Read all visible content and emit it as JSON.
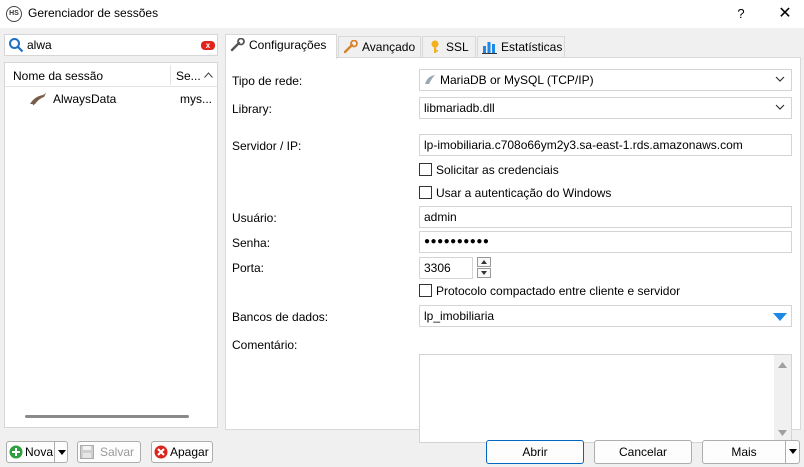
{
  "window": {
    "title": "Gerenciador de sessões",
    "help": "?",
    "close": "✕",
    "app_icon_text": "HS"
  },
  "search": {
    "value": "alwa",
    "clear_icon": "x"
  },
  "session_list": {
    "columns": [
      "Nome da sessão",
      "Se..."
    ],
    "rows": [
      {
        "name": "AlwaysData",
        "type": "mys..."
      }
    ]
  },
  "tabs": [
    {
      "label": "Configurações",
      "icon": "wrench-icon",
      "active": true
    },
    {
      "label": "Avançado",
      "icon": "wrench-orange-icon"
    },
    {
      "label": "SSL",
      "icon": "key-icon"
    },
    {
      "label": "Estatísticas",
      "icon": "bar-chart-icon"
    }
  ],
  "form": {
    "network_type_label": "Tipo de rede:",
    "network_type_value": "MariaDB or MySQL (TCP/IP)",
    "library_label": "Library:",
    "library_value": "libmariadb.dll",
    "server_label": "Servidor / IP:",
    "server_value": "lp-imobiliaria.c708o66ym2y3.sa-east-1.rds.amazonaws.com",
    "prompt_credentials": "Solicitar as credenciais",
    "windows_auth": "Usar a autenticação do Windows",
    "user_label": "Usuário:",
    "user_value": "admin",
    "password_label": "Senha:",
    "password_value": "●●●●●●●●●●",
    "port_label": "Porta:",
    "port_value": "3306",
    "compressed": "Protocolo compactado entre cliente e servidor",
    "databases_label": "Bancos de dados:",
    "databases_value": "lp_imobiliaria",
    "comment_label": "Comentário:",
    "comment_value": ""
  },
  "buttons": {
    "new": "Nova",
    "save": "Salvar",
    "delete": "Apagar",
    "open": "Abrir",
    "cancel": "Cancelar",
    "more": "Mais"
  },
  "colors": {
    "accent": "#0067c0",
    "clear_red": "#e2231a",
    "db_arrow": "#1e88e5"
  }
}
